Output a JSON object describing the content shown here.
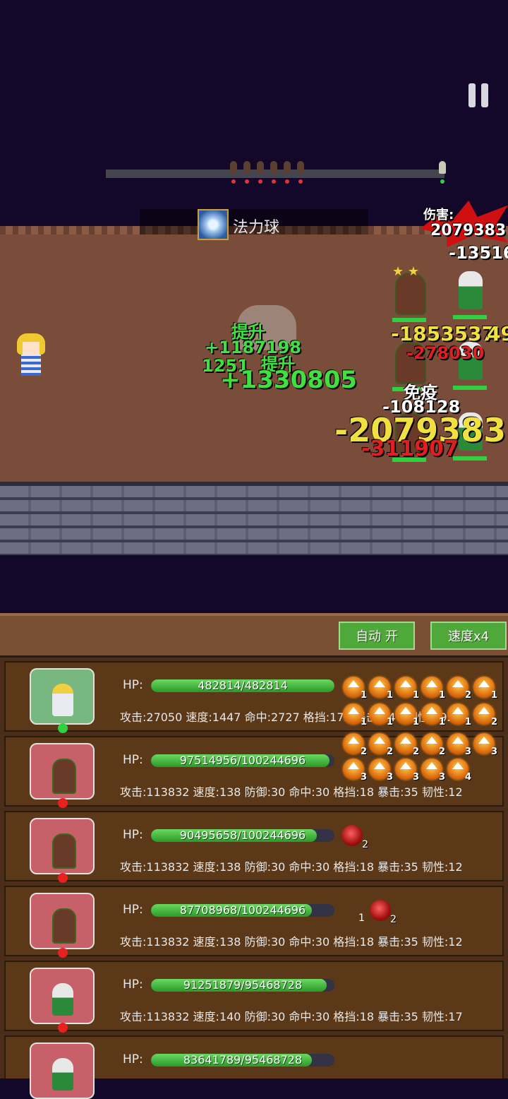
{
  "battle": {
    "skill_name": "法力球",
    "damage_label": "伤害:",
    "damage_total": "2079383",
    "floating_texts": {
      "boost1": "提升",
      "boost2": "提升",
      "heal1": "+1187198",
      "heal2": "1251",
      "heal3": "+1330805",
      "dmg_top": "-13516",
      "dmg1": "-1853537",
      "dmg1b": "49",
      "dmg2": "-278030",
      "immune": "免疫",
      "dmg3": "-108128",
      "dmg_big": "-2079383",
      "dmg_red": "-311907"
    }
  },
  "controls": {
    "auto_label": "自动 开",
    "speed_label": "速度x4"
  },
  "units": [
    {
      "hp": "482814/482814",
      "hp_ratio": 1.0,
      "stats": "攻击:27050 速度:1447 命中:2727 格挡:173 暴击:147 韧性:192",
      "buffs_row1": [
        "1",
        "1",
        "1",
        "1",
        "2",
        "1"
      ],
      "buffs_row2": [
        "1",
        "1",
        "1",
        "1",
        "1",
        "2"
      ]
    },
    {
      "hp": "97514956/100244696",
      "hp_ratio": 0.973,
      "stats": "攻击:113832 速度:138 防御:30 命中:30 格挡:18 暴击:35 韧性:12",
      "buffs_row1": [
        "2",
        "2",
        "2",
        "2",
        "3",
        "3"
      ],
      "buffs_row2": [
        "3",
        "3",
        "3",
        "3",
        "4"
      ]
    },
    {
      "hp": "90495658/100244696",
      "hp_ratio": 0.903,
      "stats": "攻击:113832 速度:138 防御:30 命中:30 格挡:18 暴击:35 韧性:12",
      "debuff_count": "2"
    },
    {
      "hp": "87708968/100244696",
      "hp_ratio": 0.875,
      "stats": "攻击:113832 速度:138 防御:30 命中:30 格挡:18 暴击:35 韧性:12",
      "debuff_prefix": "1",
      "debuff_count": "2"
    },
    {
      "hp": "91251879/95468728",
      "hp_ratio": 0.956,
      "stats": "攻击:113832 速度:140 防御:30 命中:30 格挡:18 暴击:35 韧性:17"
    },
    {
      "hp": "83641789/95468728",
      "hp_ratio": 0.876
    }
  ],
  "hp_label": "HP:"
}
